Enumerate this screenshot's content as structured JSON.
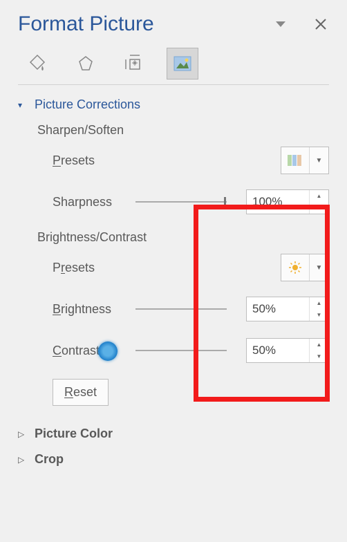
{
  "header": {
    "title": "Format Picture"
  },
  "section": {
    "corrections_label": "Picture Corrections",
    "sharpen_label": "Sharpen/Soften",
    "presets_label": "Presets",
    "sharpness_label": "Sharpness",
    "brightcontrast_label": "Brightness/Contrast",
    "brightness_label": "Brightness",
    "contrast_label": "Contrast",
    "reset_label": "Reset",
    "color_label": "Picture Color",
    "crop_label": "Crop"
  },
  "values": {
    "sharpness": "100%",
    "brightness": "50%",
    "contrast": "50%"
  }
}
